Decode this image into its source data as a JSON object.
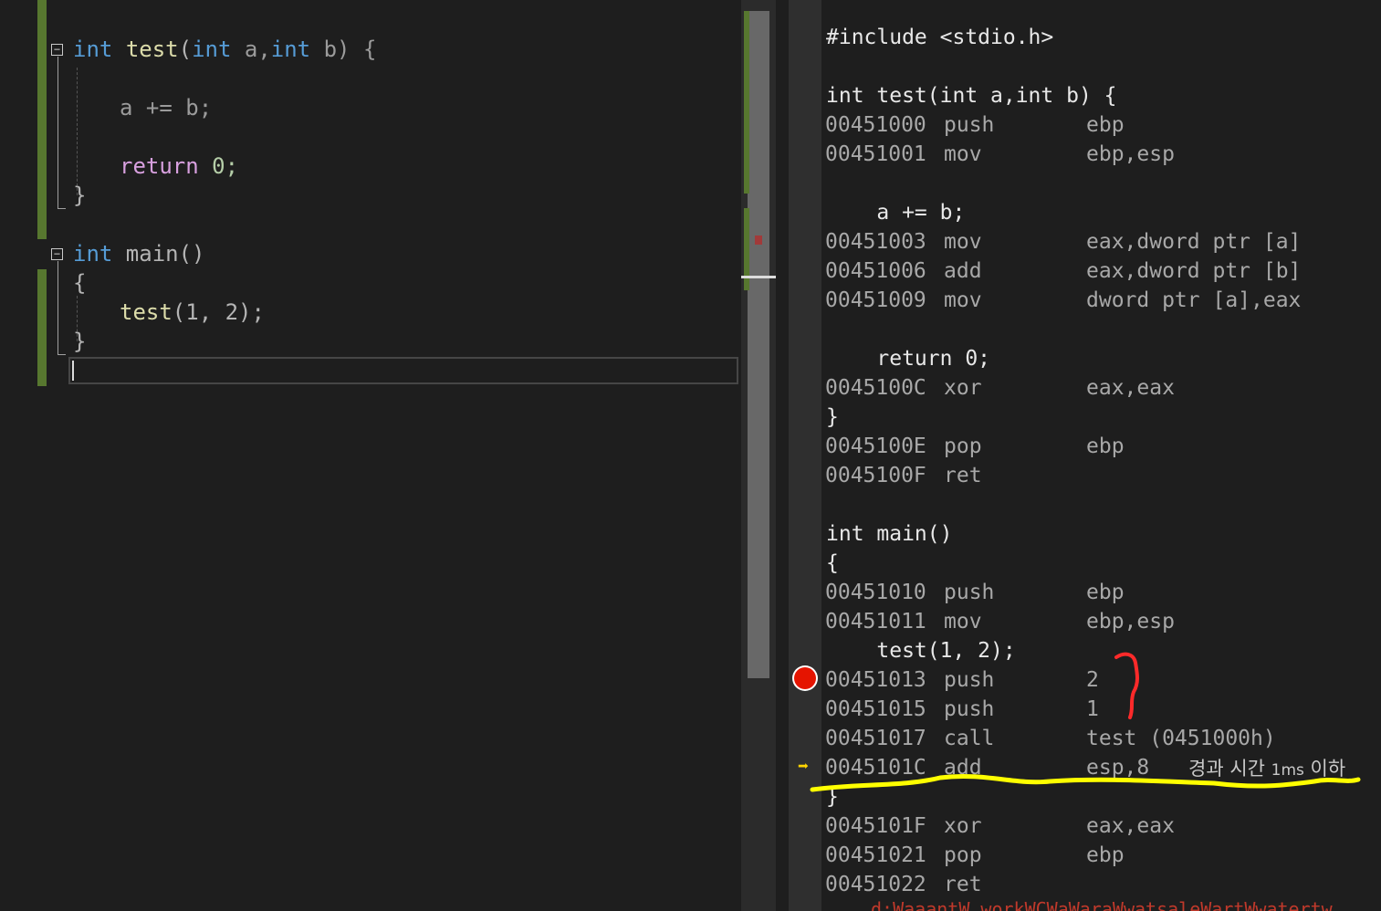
{
  "editor": {
    "lines": {
      "test_sig": {
        "kw_int": "int",
        "fn": "test",
        "open": "(",
        "kw_int2": "int",
        "a": " a,",
        "kw_int3": "int",
        "b": " b) {"
      },
      "add": "a += b;",
      "ret_kw": "return",
      "ret_val": " 0;",
      "close1": "}",
      "main_kw": "int",
      "main_name": " main()",
      "open2": "{",
      "call_fn": "test",
      "call_args": "(1, 2);",
      "close2": "}"
    },
    "fold_glyph": "−"
  },
  "disasm": {
    "lines": [
      {
        "kind": "src",
        "text": "#include <stdio.h>"
      },
      {
        "kind": "src",
        "text": "int test(int a,int b) {"
      },
      {
        "kind": "asm",
        "addr": "00451000",
        "mn": "push",
        "op": "ebp"
      },
      {
        "kind": "asm",
        "addr": "00451001",
        "mn": "mov",
        "op": "ebp,esp"
      },
      {
        "kind": "src",
        "text": "    a += b;"
      },
      {
        "kind": "asm",
        "addr": "00451003",
        "mn": "mov",
        "op": "eax,dword ptr [a]"
      },
      {
        "kind": "asm",
        "addr": "00451006",
        "mn": "add",
        "op": "eax,dword ptr [b]"
      },
      {
        "kind": "asm",
        "addr": "00451009",
        "mn": "mov",
        "op": "dword ptr [a],eax"
      },
      {
        "kind": "src",
        "text": "    return 0;"
      },
      {
        "kind": "asm",
        "addr": "0045100C",
        "mn": "xor",
        "op": "eax,eax"
      },
      {
        "kind": "src",
        "text": "}"
      },
      {
        "kind": "asm",
        "addr": "0045100E",
        "mn": "pop",
        "op": "ebp"
      },
      {
        "kind": "asm",
        "addr": "0045100F",
        "mn": "ret",
        "op": ""
      },
      {
        "kind": "src",
        "text": "int main()"
      },
      {
        "kind": "src",
        "text": "{"
      },
      {
        "kind": "asm",
        "addr": "00451010",
        "mn": "push",
        "op": "ebp"
      },
      {
        "kind": "asm",
        "addr": "00451011",
        "mn": "mov",
        "op": "ebp,esp"
      },
      {
        "kind": "src",
        "text": "    test(1, 2);"
      },
      {
        "kind": "asm",
        "addr": "00451013",
        "mn": "push",
        "op": "2"
      },
      {
        "kind": "asm",
        "addr": "00451015",
        "mn": "push",
        "op": "1"
      },
      {
        "kind": "asm",
        "addr": "00451017",
        "mn": "call",
        "op": "test (0451000h)"
      },
      {
        "kind": "asm",
        "addr": "0045101C",
        "mn": "add",
        "op": "esp,8"
      },
      {
        "kind": "src",
        "text": "}"
      },
      {
        "kind": "asm",
        "addr": "0045101F",
        "mn": "xor",
        "op": "eax,eax"
      },
      {
        "kind": "asm",
        "addr": "00451021",
        "mn": "pop",
        "op": "ebp"
      },
      {
        "kind": "asm",
        "addr": "00451022",
        "mn": "ret",
        "op": ""
      }
    ],
    "elapsed_tip": {
      "prefix": "경과 시간 ",
      "ms": "1ms",
      "suffix": " 이하"
    },
    "status_text": "d:WaaantW workWCWaWaraWwatsaleWartWwatertw"
  },
  "icons": {
    "breakpoint": "breakpoint-icon",
    "instruction_pointer": "instruction-pointer-icon"
  },
  "colors": {
    "keyword": "#569cd6",
    "control_keyword": "#d8a0df",
    "function": "#dcdcaa",
    "number": "#b5cea8",
    "breakpoint": "#e51400",
    "instruction_pointer": "#ffd400",
    "annotation_yellow": "#ffff00",
    "annotation_red": "#ff2a2a"
  }
}
